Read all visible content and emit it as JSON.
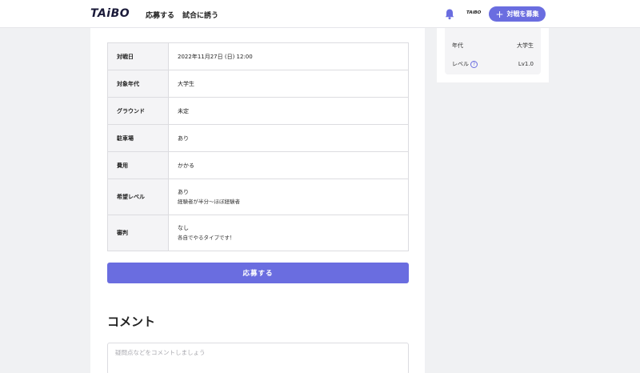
{
  "header": {
    "logo": "TAiBO",
    "nav": {
      "apply": "応募する",
      "invite": "試合に誘う"
    },
    "mini_logo": "TAiBO",
    "recruit_button": "対戦を募集"
  },
  "details": {
    "rows": [
      {
        "key": "対戦日",
        "value": "2022年11月27日 (日) 12:00"
      },
      {
        "key": "対象年代",
        "value": "大学生"
      },
      {
        "key": "グラウンド",
        "value": "未定"
      },
      {
        "key": "駐車場",
        "value": "あり"
      },
      {
        "key": "費用",
        "value": "かかる"
      },
      {
        "key": "希望レベル",
        "value": "あり",
        "sub": "経験者が半分～ほぼ経験者"
      },
      {
        "key": "審判",
        "value": "なし",
        "sub": "各自でやるタイプです！"
      }
    ]
  },
  "apply_button": "応募する",
  "comment": {
    "title": "コメント",
    "placeholder": "疑問点などをコメントしましょう"
  },
  "side": {
    "age_label": "年代",
    "age_value": "大学生",
    "level_label": "レベル",
    "level_value": "Lv1.0"
  },
  "colors": {
    "accent": "#6a6de0",
    "background": "#f0f1f3"
  },
  "icons": {
    "bell": "bell-icon",
    "plus": "plus-icon",
    "help": "question-circle-icon"
  }
}
